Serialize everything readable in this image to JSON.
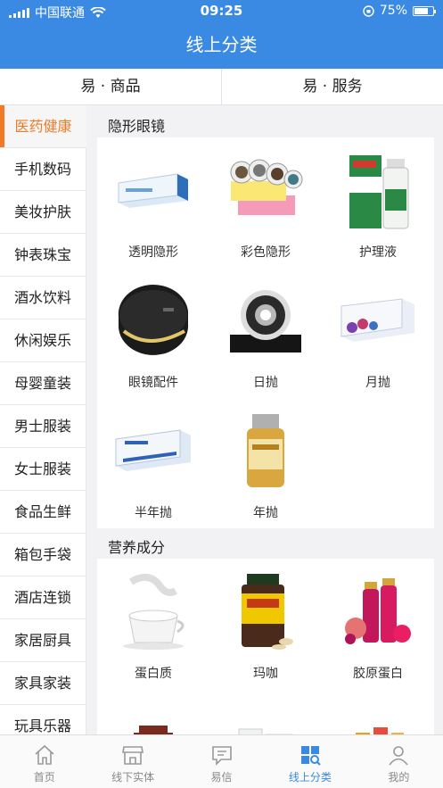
{
  "status": {
    "carrier": "中国联通",
    "time": "09:25",
    "battery": "75%",
    "battery_level": 0.75
  },
  "header": {
    "title": "线上分类"
  },
  "segments": [
    "易 · 商品",
    "易 · 服务"
  ],
  "sidebar": {
    "items": [
      "医药健康",
      "手机数码",
      "美妆护肤",
      "钟表珠宝",
      "酒水饮料",
      "休闲娱乐",
      "母婴童装",
      "男士服装",
      "女士服装",
      "食品生鲜",
      "箱包手袋",
      "酒店连锁",
      "家居厨具",
      "家具家装",
      "玩具乐器"
    ],
    "active_index": 0
  },
  "sections": [
    {
      "title": "隐形眼镜",
      "items": [
        "透明隐形",
        "彩色隐形",
        "护理液",
        "眼镜配件",
        "日抛",
        "月抛",
        "半年抛",
        "年抛"
      ]
    },
    {
      "title": "营养成分",
      "items": [
        "蛋白质",
        "玛咖",
        "胶原蛋白",
        "",
        "",
        ""
      ]
    }
  ],
  "tabbar": {
    "items": [
      "首页",
      "线下实体",
      "易信",
      "线上分类",
      "我的"
    ],
    "active_index": 3
  },
  "colors": {
    "brand_blue": "#3a8ae3",
    "accent_orange": "#f07a28"
  }
}
